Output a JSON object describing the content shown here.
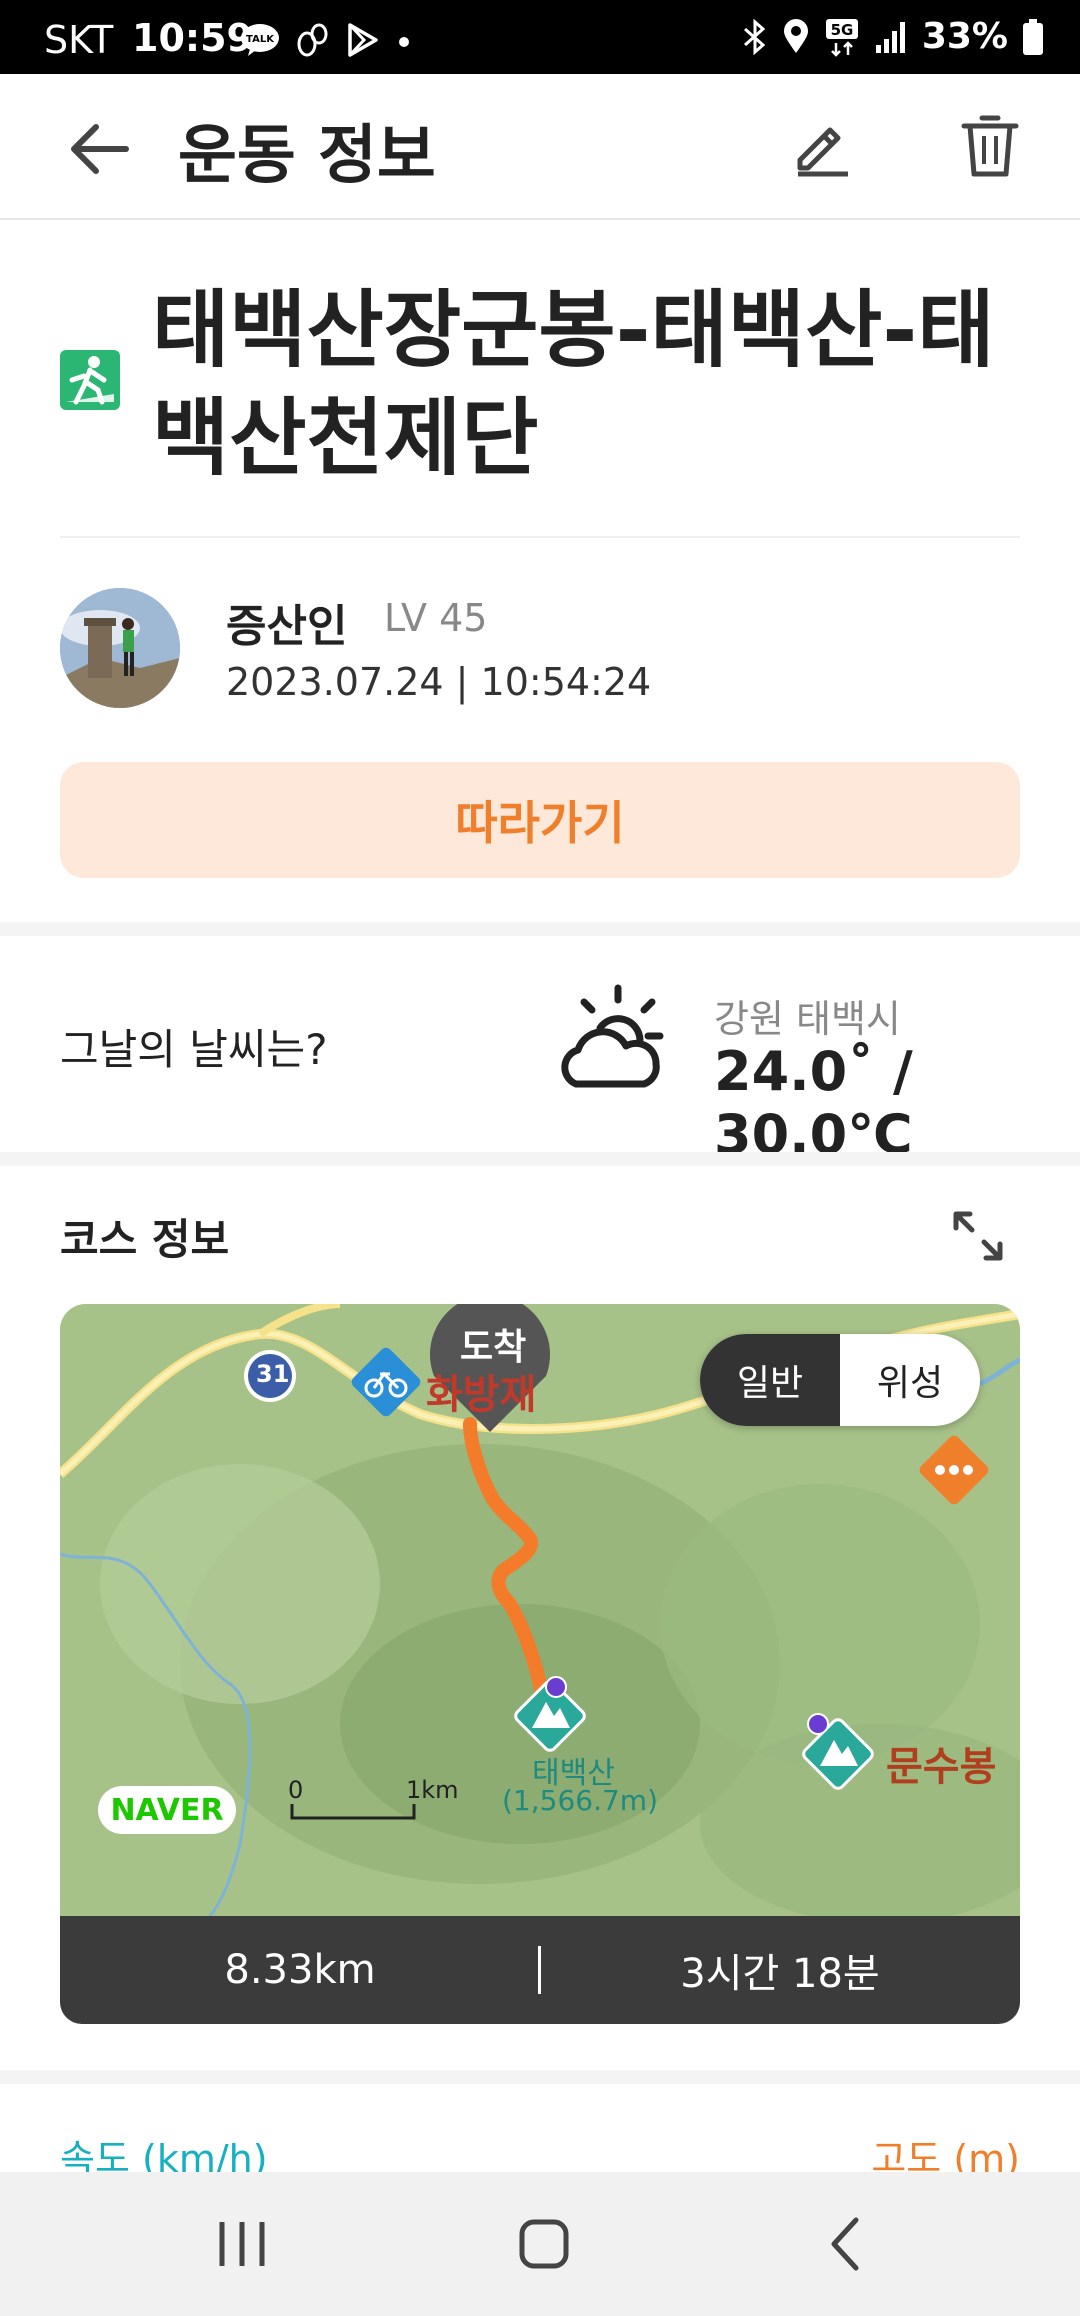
{
  "status_bar": {
    "carrier": "SKT",
    "time": "10:59",
    "battery": "33%",
    "icons": [
      "talk-icon",
      "step-icon",
      "play-icon",
      "dot-icon",
      "bluetooth-icon",
      "location-icon",
      "5g-icon",
      "signal-icon",
      "battery-icon"
    ]
  },
  "app_bar": {
    "title": "운동 정보",
    "icons": [
      "back-arrow-icon",
      "edit-icon",
      "trash-icon"
    ]
  },
  "activity": {
    "title": "태백산장군봉-태백산-태백산천제단",
    "icon": "hiking-icon",
    "accent": "#2bb673"
  },
  "user": {
    "name": "증산인",
    "level": "LV 45",
    "datetime": "2023.07.24 | 10:54:24"
  },
  "follow_button": {
    "label": "따라가기",
    "color": "#f07f2b",
    "background": "#fde8da"
  },
  "weather": {
    "question": "그날의 날씨는?",
    "location": "강원 태백시",
    "temperature": "24.0˚ / 30.0℃",
    "icon": "partly-cloudy-icon"
  },
  "course": {
    "title": "코스 정보",
    "map": {
      "toggle": [
        "일반",
        "위성"
      ],
      "selected": "일반",
      "arrival_marker": "도착",
      "route_number": "31",
      "place_label_partial": "화방재",
      "peak_main": "태백산",
      "peak_main_elev": "(1,566.7m)",
      "peak_second": "문수봉",
      "scale_zero": "0",
      "scale_unit": "1km",
      "logo": "NAVER",
      "route_color": "#f47b29"
    },
    "distance": "8.33km",
    "duration": "3시간 18분"
  },
  "chart_header": {
    "speed_label": "속도 (km/h)",
    "altitude_label": "고도 (m)"
  },
  "nav_bar": {
    "icons": [
      "recent-apps-icon",
      "home-icon",
      "back-icon"
    ]
  }
}
